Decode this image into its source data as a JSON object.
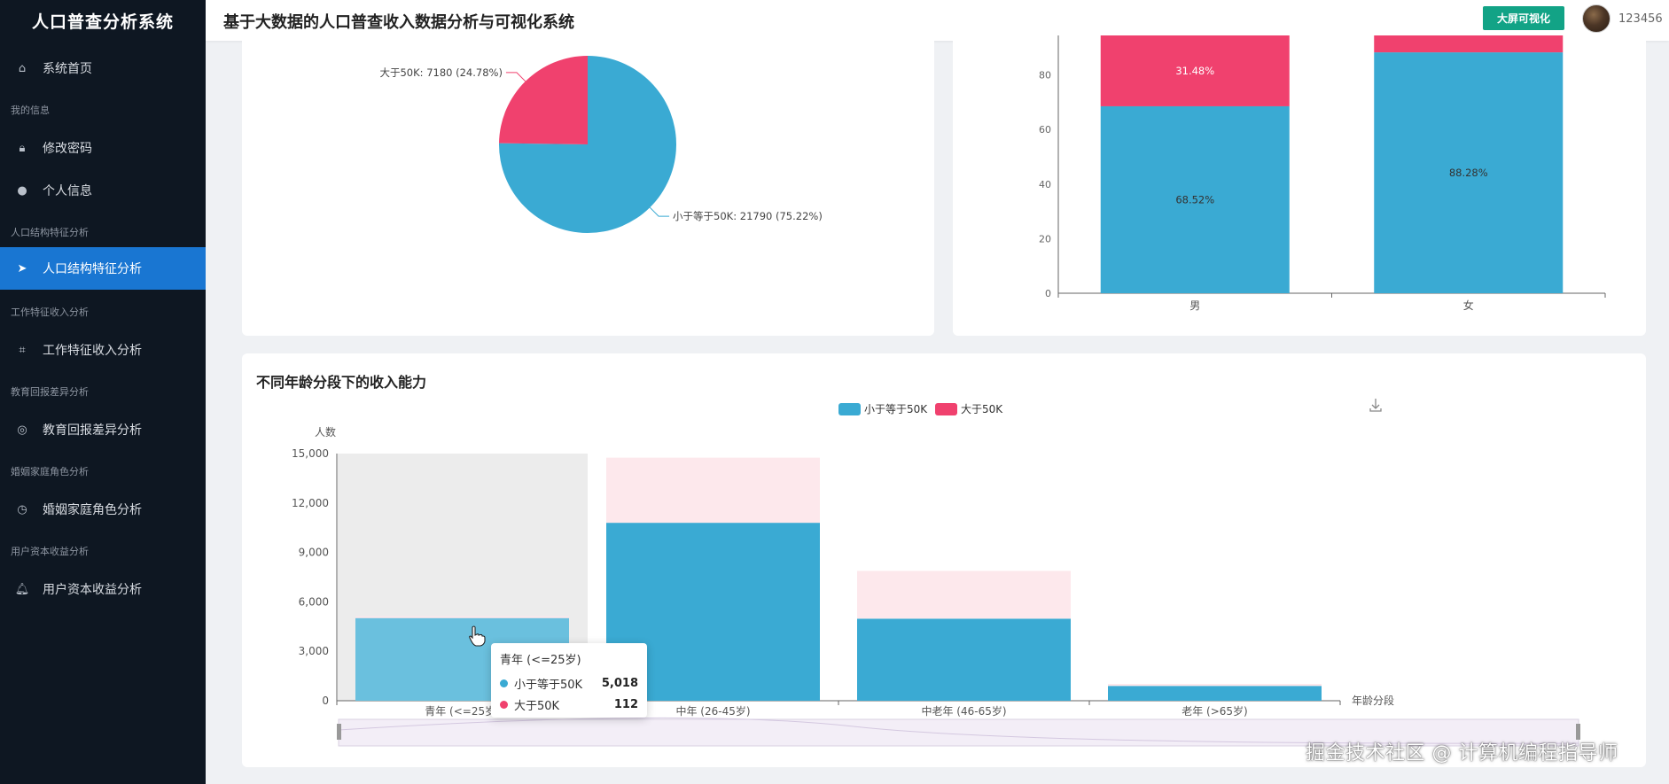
{
  "app": {
    "brand": "人口普查分析系统",
    "header_title": "基于大数据的人口普查收入数据分析与可视化系统",
    "big_screen_button": "大屏可视化",
    "username": "123456"
  },
  "sidebar": {
    "items": [
      {
        "label": "系统首页",
        "icon": "home-icon"
      },
      {
        "group": "我的信息"
      },
      {
        "label": "修改密码",
        "icon": "lock-icon"
      },
      {
        "label": "个人信息",
        "icon": "user-icon"
      },
      {
        "group": "人口结构特征分析"
      },
      {
        "label": "人口结构特征分析",
        "icon": "send-icon",
        "active": true
      },
      {
        "group": "工作特征收入分析"
      },
      {
        "label": "工作特征收入分析",
        "icon": "crop-icon"
      },
      {
        "group": "教育回报差异分析"
      },
      {
        "label": "教育回报差异分析",
        "icon": "target-icon"
      },
      {
        "group": "婚姻家庭角色分析"
      },
      {
        "label": "婚姻家庭角色分析",
        "icon": "clock-icon"
      },
      {
        "group": "用户资本收益分析"
      },
      {
        "label": "用户资本收益分析",
        "icon": "bell-icon"
      }
    ]
  },
  "colors": {
    "blue": "#3aaad3",
    "pink": "#f0416e",
    "pink_faded": "#fde8ec",
    "sidebar_bg": "#0e1722",
    "active_bg": "#1976d2",
    "button_green": "#12a386"
  },
  "chart_data": [
    {
      "type": "pie",
      "title": "",
      "slices": [
        {
          "label": "小于等于50K: 21790 (75.22%)",
          "name": "小于等于50K",
          "value": 21790,
          "percent": 75.22
        },
        {
          "label": "大于50K: 7180 (24.78%)",
          "name": "大于50K",
          "value": 7180,
          "percent": 24.78
        }
      ]
    },
    {
      "type": "bar",
      "stacked": true,
      "title": "",
      "categories": [
        "男",
        "女"
      ],
      "ylim": [
        0,
        100
      ],
      "yticks": [
        "0",
        "20",
        "40",
        "60",
        "80"
      ],
      "series": [
        {
          "values": [
            68.52,
            88.28
          ],
          "labels": [
            "68.52%",
            "88.28%"
          ]
        },
        {
          "values": [
            31.48,
            11.72
          ],
          "labels": [
            "31.48%",
            ""
          ]
        }
      ]
    },
    {
      "type": "bar",
      "stacked": true,
      "title": "不同年龄分段下的收入能力",
      "ylabel": "人数",
      "xlabel": "年龄分段",
      "categories": [
        "青年 (<=25岁)",
        "中年 (26-45岁)",
        "中老年 (46-65岁)",
        "老年 (>65岁)"
      ],
      "ylim": [
        0,
        15000
      ],
      "yticks": [
        "0",
        "3,000",
        "6,000",
        "9,000",
        "12,000",
        "15,000"
      ],
      "legend": "top-center",
      "series": [
        {
          "name": "小于等于50K",
          "values": [
            5018,
            10800,
            4980,
            900
          ]
        },
        {
          "name": "大于50K",
          "values": [
            112,
            3950,
            2900,
            120
          ]
        }
      ],
      "tooltip": {
        "title": "青年 (<=25岁)",
        "rows": [
          {
            "name": "小于等于50K",
            "value": "5,018"
          },
          {
            "name": "大于50K",
            "value": "112"
          }
        ]
      }
    }
  ],
  "watermark": "掘金技术社区 @ 计算机编程指导师"
}
